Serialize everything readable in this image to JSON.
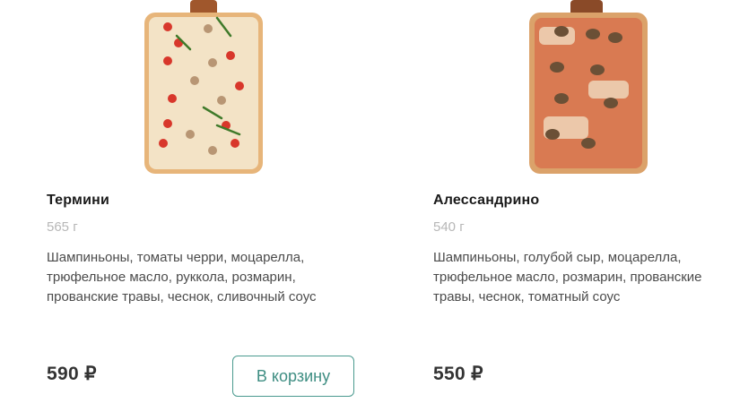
{
  "products": [
    {
      "name": "Термини",
      "weight": "565 г",
      "description_lines": [
        "Шампиньоны, томаты черри, моцарелла,",
        "трюфельное масло, руккола, розмарин,",
        "прованские травы, чеснок, сливочный соус"
      ],
      "price": "590 ₽",
      "cart_button": "В корзину"
    },
    {
      "name": "Алессандрино",
      "weight": "540 г",
      "description_lines": [
        "Шампиньоны, голубой сыр, моцарелла,",
        "трюфельное масло, розмарин, прованские",
        "травы, чеснок, томатный соус"
      ],
      "price": "550 ₽"
    }
  ],
  "colors": {
    "accent": "#3f8e83",
    "weight_text": "#b7b7b7",
    "description_text": "#4b4b4b"
  }
}
